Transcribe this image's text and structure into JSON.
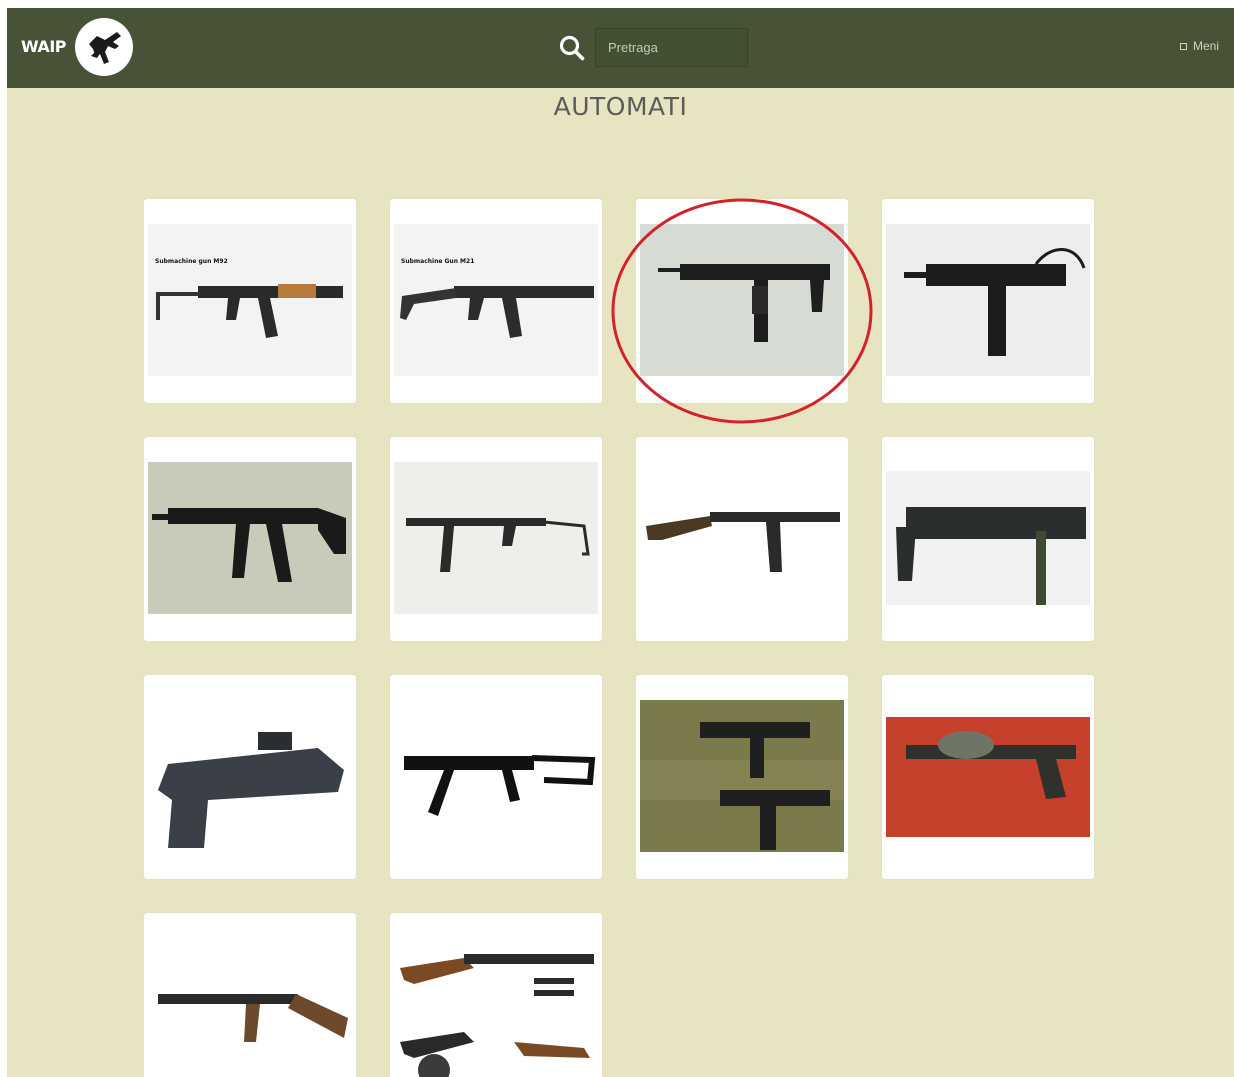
{
  "navbar": {
    "brand": "WAIP",
    "search_placeholder": "Pretraga",
    "menu_label": "Meni"
  },
  "page": {
    "title": "AUTOMATI"
  },
  "products": [
    {
      "image": "submachine-gun-m92",
      "caption": "Submachine gun M92"
    },
    {
      "image": "submachine-gun-m21",
      "caption": "Submachine Gun M21"
    },
    {
      "image": "uzi",
      "caption": ""
    },
    {
      "image": "mini-uzi",
      "caption": ""
    },
    {
      "image": "mp5",
      "caption": ""
    },
    {
      "image": "mp40",
      "caption": ""
    },
    {
      "image": "wooden-stock-smg",
      "caption": ""
    },
    {
      "image": "bizon",
      "caption": ""
    },
    {
      "image": "mp7",
      "caption": ""
    },
    {
      "image": "ump",
      "caption": ""
    },
    {
      "image": "two-uzis-on-grass",
      "caption": ""
    },
    {
      "image": "drum-smg-on-red",
      "caption": ""
    },
    {
      "image": "thompson",
      "caption": ""
    },
    {
      "image": "ppsh",
      "caption": ""
    }
  ],
  "colors": {
    "navbar": "#475236",
    "page_background": "#e7e4c1",
    "highlight": "#d2232a"
  }
}
